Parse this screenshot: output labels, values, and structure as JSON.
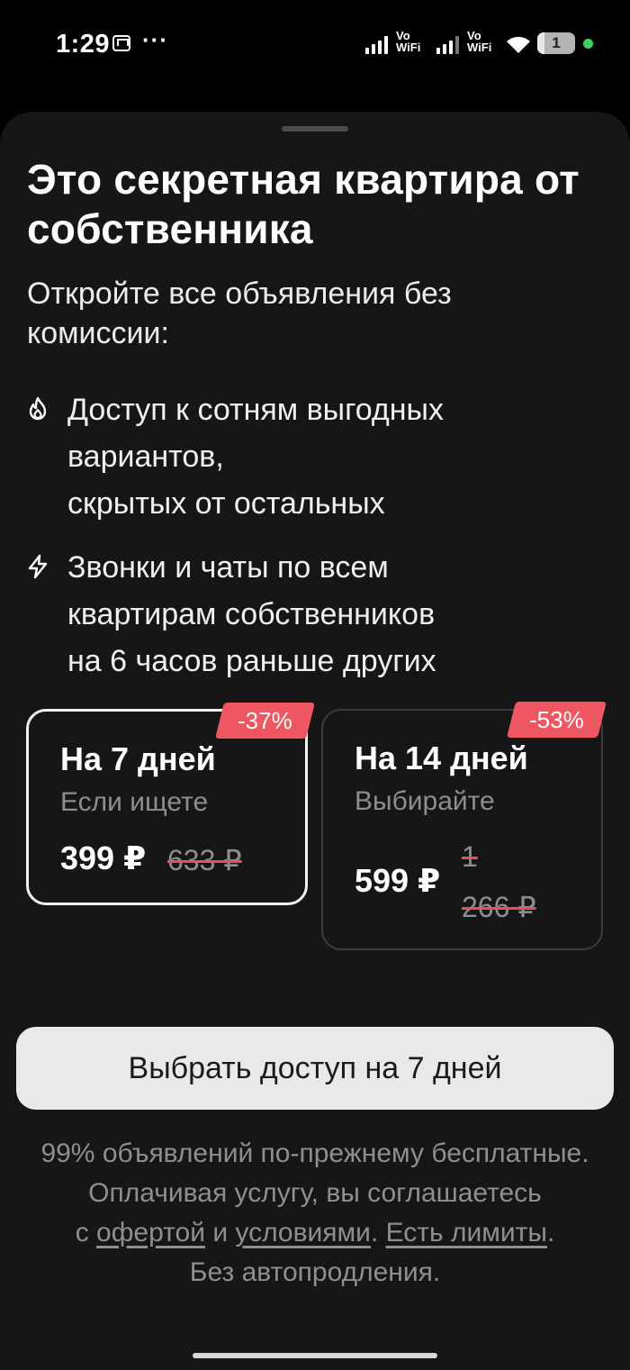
{
  "status_bar": {
    "time": "1:29",
    "overflow": "···",
    "vowifi_1": "Vo\nWiFi",
    "vowifi_2": "Vo\nWiFi",
    "battery": "1",
    "icons": [
      "gmail-icon",
      "signal-icon",
      "vowifi-icon",
      "signal-icon",
      "vowifi-icon",
      "wifi-icon",
      "battery-icon"
    ]
  },
  "sheet": {
    "title": "Это секретная квартира от собственника",
    "subtitle": "Откройте все объявления без комиссии:",
    "features": [
      {
        "icon": "flame-icon",
        "text": "Доступ к сотням выгодных\nвариантов,\nскрытых от остальных"
      },
      {
        "icon": "lightning-icon",
        "text": "Звонки и чаты по всем\nквартирам собственников\nна 6 часов раньше других"
      }
    ],
    "plans": [
      {
        "name": "На 7 дней",
        "desc": "Если ищете",
        "price": "399 ₽",
        "old_price": "633 ₽",
        "discount": "-37%",
        "selected": true
      },
      {
        "name": "На 14 дней",
        "desc": "Выбирайте",
        "price": "599 ₽",
        "old_price": "1\n266 ₽",
        "discount": "-53%",
        "selected": false
      }
    ],
    "cta_label": "Выбрать доступ на 7 дней",
    "footer": {
      "line1": "99% объявлений по-прежнему бесплатные.",
      "line2": "Оплачивая услугу, вы соглашаетесь",
      "prefix": "с ",
      "offer_link": "офертой",
      "and": " и ",
      "terms_link": "условиями",
      "sep": ". ",
      "limits_link": "Есть лимиты",
      "end": ".",
      "line4": "Без автопродления."
    }
  },
  "colors": {
    "background": "#161616",
    "accent_badge": "#ee5662",
    "cta_bg": "#e9e9e9",
    "muted_text": "#8e8e8e"
  }
}
